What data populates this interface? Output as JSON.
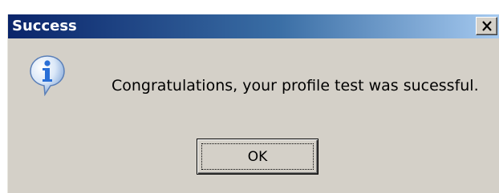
{
  "dialog": {
    "title": "Success",
    "close_button": {
      "icon": "close-icon",
      "glyph": "X"
    },
    "icon": "information-icon",
    "message": "Congratulations, your profile test was sucessful.",
    "ok_label": "OK"
  },
  "colors": {
    "title_gradient_start": "#0a246a",
    "title_gradient_end": "#a6caf0",
    "dialog_face": "#d4d0c8",
    "title_text": "#ffffff",
    "icon_fill": "#2a6fd6"
  }
}
